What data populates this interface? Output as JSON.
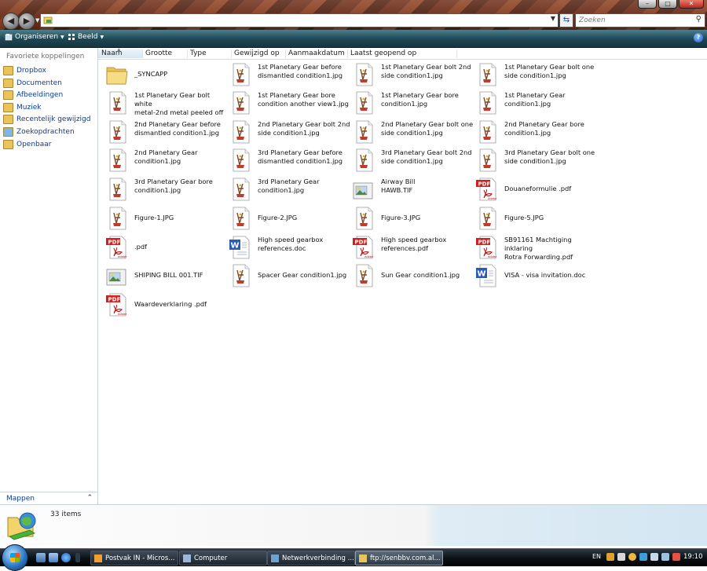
{
  "toolbar": {
    "organize_label": "Organiseren",
    "view_label": "Beeld"
  },
  "search": {
    "placeholder": "Zoeken"
  },
  "sidebar": {
    "title": "Favoriete koppelingen",
    "items": [
      {
        "label": "Dropbox",
        "icon": "folder-icon"
      },
      {
        "label": "Documenten",
        "icon": "folder-icon"
      },
      {
        "label": "Afbeeldingen",
        "icon": "folder-icon"
      },
      {
        "label": "Muziek",
        "icon": "music-icon"
      },
      {
        "label": "Recentelijk gewijzigd",
        "icon": "recent-icon"
      },
      {
        "label": "Zoekopdrachten",
        "icon": "search-folder-icon"
      },
      {
        "label": "Openbaar",
        "icon": "public-folder-icon"
      }
    ],
    "folders_label": "Mappen"
  },
  "columns": [
    "Naam",
    "Grootte",
    "Type",
    "Gewijzigd op",
    "Aanmaakdatum",
    "Laatst geopend op"
  ],
  "files": [
    {
      "name": "_SYNCAPP",
      "type": "folder"
    },
    {
      "name": "1st Planetary Gear before\ndismantled condition1.jpg",
      "type": "jpg"
    },
    {
      "name": "1st Planetary Gear bolt 2nd\nside condition1.jpg",
      "type": "jpg"
    },
    {
      "name": "1st Planetary Gear bolt one\nside condition1.jpg",
      "type": "jpg"
    },
    {
      "name": "1st Planetary Gear bolt white\nmetal-2nd metal peeled off ...",
      "type": "jpg"
    },
    {
      "name": "1st Planetary Gear bore\ncondition another view1.jpg",
      "type": "jpg"
    },
    {
      "name": "1st Planetary Gear bore\ncondition1.jpg",
      "type": "jpg"
    },
    {
      "name": "1st Planetary Gear\ncondition1.jpg",
      "type": "jpg"
    },
    {
      "name": "2nd Planetary Gear before\ndismantled condition1.jpg",
      "type": "jpg"
    },
    {
      "name": "2nd Planetary Gear bolt 2nd\nside condition1.jpg",
      "type": "jpg"
    },
    {
      "name": "2nd Planetary Gear bolt one\nside condition1.jpg",
      "type": "jpg"
    },
    {
      "name": "2nd Planetary Gear bore\ncondition1.jpg",
      "type": "jpg"
    },
    {
      "name": "2nd Planetary Gear\ncondition1.jpg",
      "type": "jpg"
    },
    {
      "name": "3rd Planetary Gear before\ndismantled condition1.jpg",
      "type": "jpg"
    },
    {
      "name": "3rd Planetary Gear bolt 2nd\nside condition1.jpg",
      "type": "jpg"
    },
    {
      "name": "3rd Planetary Gear bolt one\nside condition1.jpg",
      "type": "jpg"
    },
    {
      "name": "3rd Planetary Gear bore\ncondition1.jpg",
      "type": "jpg"
    },
    {
      "name": "3rd Planetary Gear\ncondition1.jpg",
      "type": "jpg"
    },
    {
      "name": "Airway Bill\nHAWB.TIF",
      "type": "tif"
    },
    {
      "name": "Douaneformulie .pdf",
      "type": "pdf"
    },
    {
      "name": "Figure-1.JPG",
      "type": "jpg"
    },
    {
      "name": "Figure-2.JPG",
      "type": "jpg"
    },
    {
      "name": "Figure-3.JPG",
      "type": "jpg"
    },
    {
      "name": "Figure-5.JPG",
      "type": "jpg"
    },
    {
      "name": ".pdf",
      "type": "pdf"
    },
    {
      "name": "High speed gearbox\nreferences.doc",
      "type": "doc"
    },
    {
      "name": "High speed gearbox\nreferences.pdf",
      "type": "pdf"
    },
    {
      "name": "SB91161 Machtiging inklaring\nRotra Forwarding.pdf",
      "type": "pdf"
    },
    {
      "name": "SHIPING BILL 001.TIF",
      "type": "tif"
    },
    {
      "name": "Spacer Gear condition1.jpg",
      "type": "jpg"
    },
    {
      "name": "Sun Gear  condition1.jpg",
      "type": "jpg"
    },
    {
      "name": "VISA -  visa invitation.doc",
      "type": "doc"
    },
    {
      "name": "Waardeverklaring .pdf",
      "type": "pdf"
    }
  ],
  "details": {
    "count": "33 items"
  },
  "taskbar": {
    "tasks": [
      {
        "label": "Postvak IN - Micros...",
        "icon": "outlook-icon"
      },
      {
        "label": "Computer",
        "icon": "computer-icon"
      },
      {
        "label": "Netwerkverbinding ...",
        "icon": "network-icon"
      },
      {
        "label": "ftp://senbbv.com.al...",
        "icon": "folder-icon"
      }
    ],
    "language": "EN",
    "clock": "19:10"
  },
  "window_buttons": {
    "minimize": "–",
    "maximize": "□",
    "close": "✕"
  }
}
